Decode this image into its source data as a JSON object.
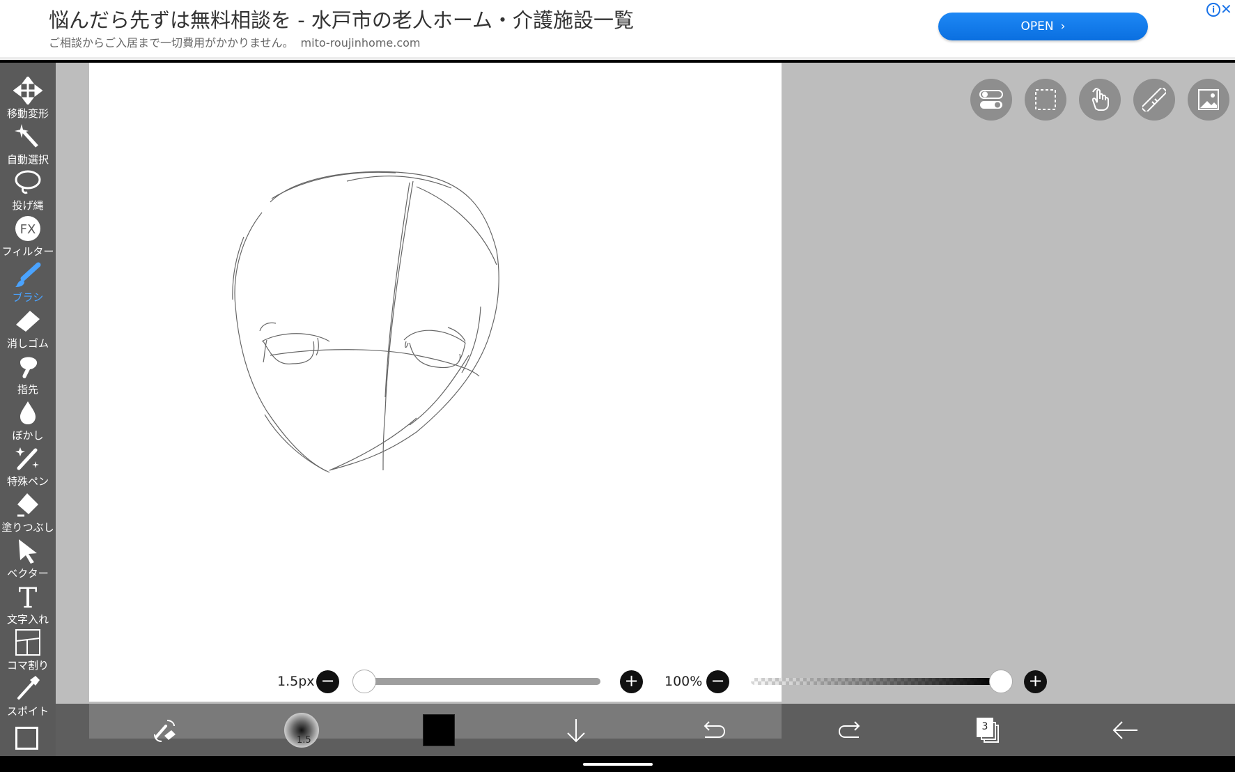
{
  "ad": {
    "title": "悩んだら先ずは無料相談を - 水戸市の老人ホーム・介護施設一覧",
    "subtitle": "ご相談からご入居まで一切費用がかかりません。",
    "url": "mito-roujinhome.com",
    "open_label": "OPEN",
    "info_icon": "info-icon",
    "close_icon": "close-icon"
  },
  "tools": [
    {
      "label": "移動変形",
      "icon": "move-transform-icon"
    },
    {
      "label": "自動選択",
      "icon": "magic-wand-icon"
    },
    {
      "label": "投げ縄",
      "icon": "lasso-icon"
    },
    {
      "label": "フィルター",
      "icon": "fx-icon"
    },
    {
      "label": "ブラシ",
      "icon": "brush-icon",
      "active": true
    },
    {
      "label": "消しゴム",
      "icon": "eraser-icon"
    },
    {
      "label": "指先",
      "icon": "finger-icon"
    },
    {
      "label": "ぼかし",
      "icon": "blur-drop-icon"
    },
    {
      "label": "特殊ペン",
      "icon": "special-pen-icon"
    },
    {
      "label": "塗りつぶし",
      "icon": "bucket-fill-icon"
    },
    {
      "label": "ベクター",
      "icon": "vector-arrow-icon"
    },
    {
      "label": "文字入れ",
      "icon": "text-icon"
    },
    {
      "label": "コマ割り",
      "icon": "panel-split-icon"
    },
    {
      "label": "スポイト",
      "icon": "eyedropper-icon"
    }
  ],
  "top_buttons": [
    "toggle-icon",
    "selection-icon",
    "hand-icon",
    "ruler-icon",
    "image-icon"
  ],
  "brush": {
    "size_label": "1.5px",
    "size_fraction": 0.0,
    "preview_text": "1.5"
  },
  "opacity": {
    "label": "100%",
    "fraction": 1.0
  },
  "color": {
    "current": "#000000",
    "accent": "#4aa3ff",
    "ad_button": "#1a73e8"
  },
  "layers": {
    "count": "3"
  },
  "bottom_icons": [
    "swap-icon",
    "brush-preview",
    "color-swatch",
    "download-arrow-icon",
    "undo-icon",
    "redo-icon",
    "layers-icon",
    "back-arrow-icon"
  ]
}
